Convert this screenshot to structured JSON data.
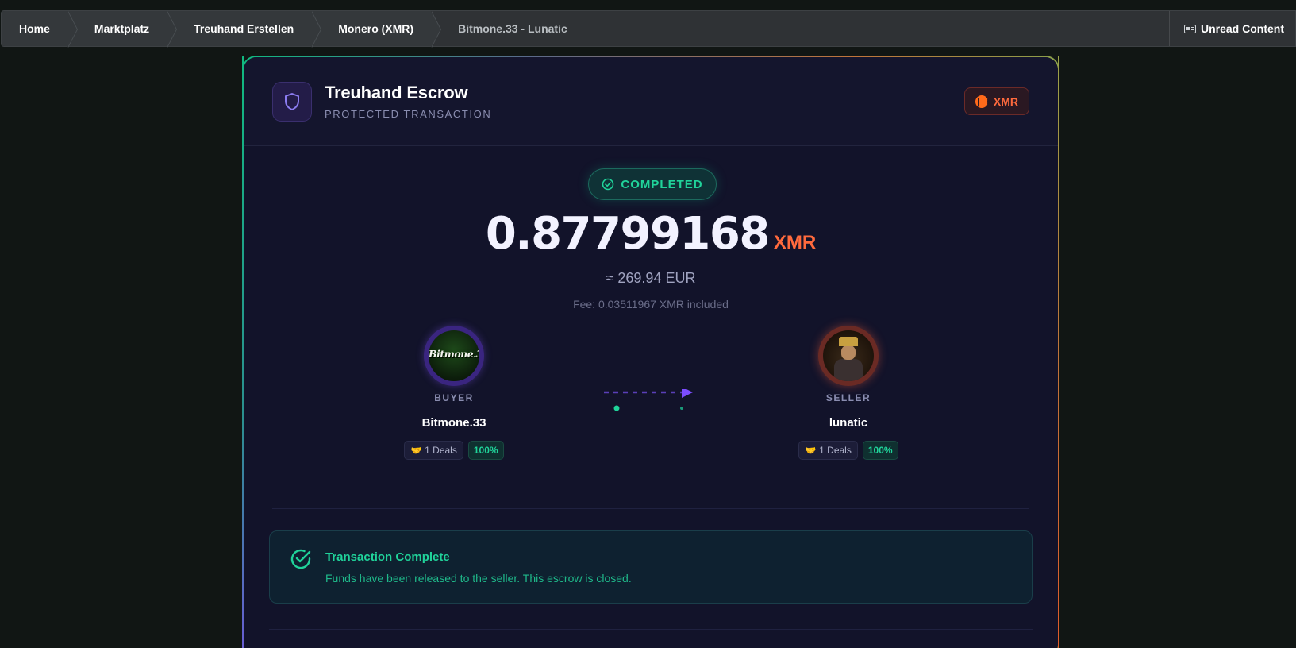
{
  "breadcrumb": {
    "items": [
      "Home",
      "Marktplatz",
      "Treuhand Erstellen",
      "Monero (XMR)"
    ],
    "current": "Bitmone.33 - Lunatic",
    "unread": "Unread Content"
  },
  "escrow": {
    "title": "Treuhand Escrow",
    "subtitle": "PROTECTED TRANSACTION",
    "currency_badge": "XMR",
    "status": "COMPLETED",
    "amount": "0.87799168",
    "amount_unit": "XMR",
    "fiat": "≈ 269.94 EUR",
    "fee": "Fee: 0.03511967 XMR included"
  },
  "buyer": {
    "role": "BUYER",
    "name": "Bitmone.33",
    "avatar_text": "Bitmone.33",
    "deals": "1 Deals",
    "rating": "100%"
  },
  "seller": {
    "role": "SELLER",
    "name": "lunatic",
    "deals": "1 Deals",
    "rating": "100%"
  },
  "notice": {
    "title": "Transaction Complete",
    "text": "Funds have been released to the seller. This escrow is closed."
  },
  "colors": {
    "accent_green": "#20d39a",
    "monero_orange": "#ff6a3d",
    "buyer_purple": "#3a2580",
    "seller_red": "#6a2a24"
  },
  "icons": [
    "shield-icon",
    "monero-icon",
    "check-circle-icon",
    "handshake-icon",
    "newspaper-icon"
  ]
}
